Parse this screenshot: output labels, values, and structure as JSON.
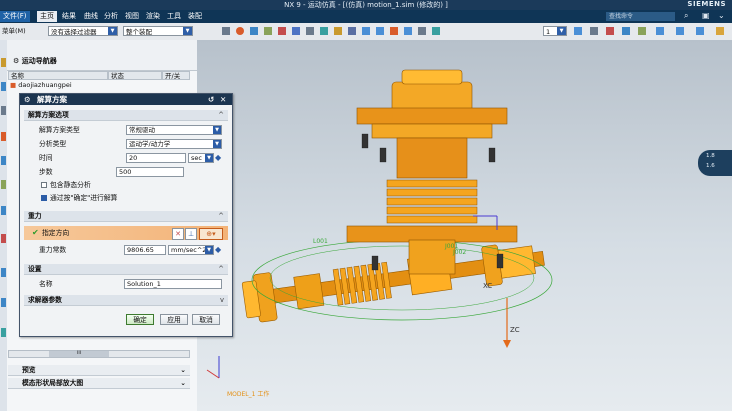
{
  "window": {
    "title": "NX 9 - 运动仿真 - [(仿真) motion_1.sim  (修改的) ]",
    "brand": "SIEMENS"
  },
  "menubar": {
    "items": [
      "文件(F)",
      "主页",
      "结果",
      "曲线",
      "分析",
      "视图",
      "渲染",
      "工具",
      "装配"
    ],
    "search_placeholder": "查找命令"
  },
  "toolbar": {
    "menu_label": "菜单(M)",
    "filter_value": "没有选择过滤器",
    "scope_value": "整个装配",
    "layer_value": "1"
  },
  "navigator": {
    "title": "运动导航器",
    "columns": [
      "名称",
      "状态",
      "开/关"
    ],
    "root_item": "daojiazhuangpei",
    "scroll_label": "III",
    "bottom_panels": [
      "预览",
      "模态形状局部放大图"
    ]
  },
  "dialog": {
    "title": "解算方案",
    "sections": {
      "options": "解算方案选项",
      "gravity": "重力",
      "settings": "设置",
      "solver_params": "求解器参数"
    },
    "fields": {
      "solution_type": {
        "label": "解算方案类型",
        "value": "常规驱动"
      },
      "analysis_type": {
        "label": "分析类型",
        "value": "运动学/动力学"
      },
      "time": {
        "label": "时间",
        "value": "20",
        "unit": "sec"
      },
      "steps": {
        "label": "步数",
        "value": "500"
      },
      "static_check": {
        "label": "包含静态分析",
        "checked": false
      },
      "solve_on_ok": {
        "label": "通过按\"确定\"进行解算",
        "checked": true
      },
      "direction": {
        "label": "指定方向"
      },
      "gravity_const": {
        "label": "重力常数",
        "value": "9806.65",
        "unit": "mm/sec^2"
      },
      "name": {
        "label": "名称",
        "value": "Solution_1"
      }
    },
    "buttons": {
      "ok": "确定",
      "apply": "应用",
      "cancel": "取消"
    }
  },
  "viewport": {
    "labels": [
      "L001",
      "J001",
      "J002",
      "XC",
      "ZC",
      "YC"
    ],
    "wcs_label": "MODEL_1 工作",
    "side_pill": [
      "1.8",
      "1.6"
    ]
  }
}
